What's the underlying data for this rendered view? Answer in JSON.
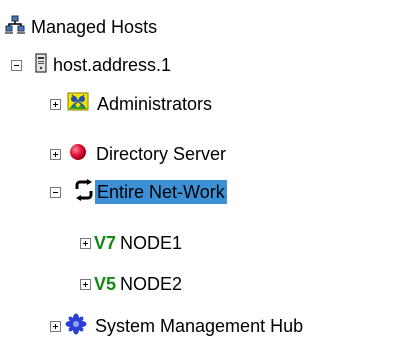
{
  "tree": {
    "root": {
      "label": "Managed Hosts",
      "icon": "network-hosts-icon"
    },
    "host": {
      "label": "host.address.1",
      "icon": "server-icon",
      "expanded": true
    },
    "items": [
      {
        "label": "Administrators",
        "icon": "administrators-icon",
        "expanded": false
      },
      {
        "label": "Directory Server",
        "icon": "red-ball-icon",
        "expanded": false
      },
      {
        "label": "Entire Net-Work",
        "icon": "network-arrows-icon",
        "expanded": true,
        "selected": true
      },
      {
        "label": "NODE1",
        "badge": "V7",
        "icon": "version-badge-icon",
        "expanded": false
      },
      {
        "label": "NODE2",
        "badge": "V5",
        "icon": "version-badge-icon",
        "expanded": false
      },
      {
        "label": "System Management Hub",
        "icon": "hub-icon",
        "expanded": false
      }
    ]
  },
  "colors": {
    "selection": "#3d8fd6",
    "version_badge": "#138a14",
    "toggle_border": "#7a7a7a"
  }
}
